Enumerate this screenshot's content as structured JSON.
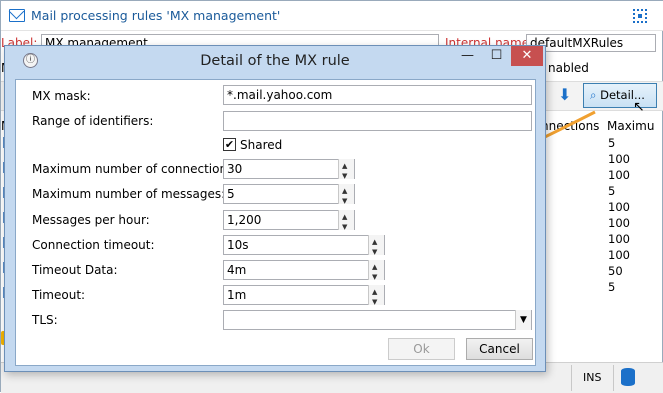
{
  "background": {
    "title": "Mail processing rules 'MX management'",
    "label_caption": "Label:",
    "label_value": "MX management",
    "internal_name_caption": "Internal name:",
    "internal_name_value": "defaultMXRules",
    "mode_partial": "Mo",
    "enabled_partial": "nabled",
    "detail_button": "Detail...",
    "col_connections": "nnections",
    "col_maximum": "Maximu",
    "col_first": "MX",
    "rows": [
      "5",
      "100",
      "100",
      "5",
      "100",
      "100",
      "100",
      "100",
      "50",
      "5"
    ],
    "status_ins": "INS"
  },
  "dialog": {
    "title": "Detail of the MX rule",
    "fields": {
      "mx_mask": {
        "label": "MX mask:",
        "value": "*.mail.yahoo.com"
      },
      "range": {
        "label": "Range of identifiers:",
        "value": ""
      },
      "shared": {
        "label": "Shared",
        "checked": true
      },
      "max_conn": {
        "label": "Maximum number of connections:",
        "value": "30"
      },
      "max_msg": {
        "label": "Maximum number of messages:",
        "value": "5"
      },
      "per_hour": {
        "label": "Messages per hour:",
        "value": "1,200"
      },
      "conn_timeout": {
        "label": "Connection timeout:",
        "value": "10s"
      },
      "timeout_data": {
        "label": "Timeout Data:",
        "value": "4m"
      },
      "timeout": {
        "label": "Timeout:",
        "value": "1m"
      },
      "tls": {
        "label": "TLS:",
        "value": ""
      }
    },
    "ok_label": "Ok",
    "cancel_label": "Cancel"
  },
  "colors": {
    "arrow": "#f0a030",
    "title_text": "#1a5a9a",
    "dialog_frame": "#c4d9f0"
  }
}
